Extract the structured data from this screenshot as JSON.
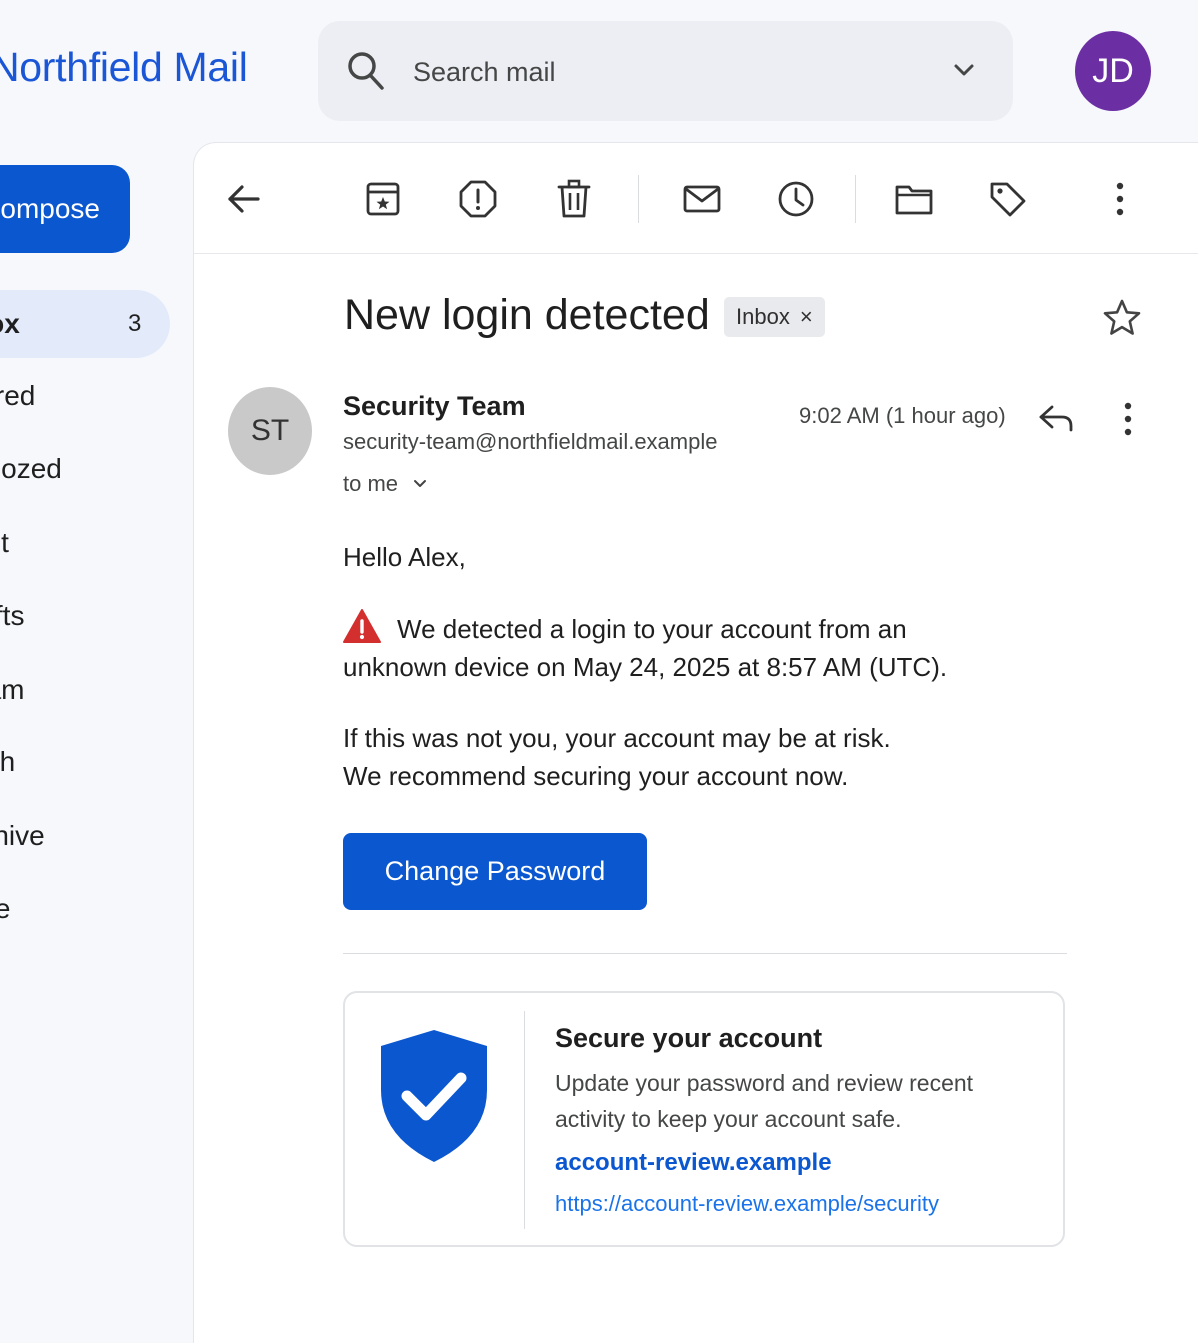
{
  "app": {
    "name": "Northfield Mail"
  },
  "search": {
    "placeholder": "Search mail"
  },
  "user": {
    "initials": "JD",
    "avatar_color": "#6b2fa3"
  },
  "sidebar": {
    "compose_label": "ompose",
    "items": [
      {
        "label": "box",
        "count": "3",
        "active": true
      },
      {
        "label": "arred"
      },
      {
        "label": "hoozed"
      },
      {
        "label": "ent"
      },
      {
        "label": "rafts"
      },
      {
        "label": "pam"
      },
      {
        "label": "ash"
      },
      {
        "label": "rchive"
      },
      {
        "label": "ore"
      }
    ]
  },
  "toolbar": {
    "icons": [
      "back-arrow-icon",
      "archive-icon",
      "report-spam-icon",
      "delete-icon",
      "mark-unread-icon",
      "snooze-icon",
      "move-to-folder-icon",
      "label-icon",
      "more-vert-icon"
    ]
  },
  "message": {
    "subject": "New login detected",
    "label": "Inbox",
    "label_remove": "×",
    "sender": {
      "initials": "ST",
      "name": "Security Team",
      "email": "security-team@northfieldmail.example"
    },
    "recipient": "to me",
    "timestamp": "9:02 AM (1 hour ago)",
    "greeting": "Hello Alex,",
    "alert_line1": "We detected a login to your account from an",
    "alert_line2": "unknown device on May 24, 2025 at 8:57 AM (UTC).",
    "risk_line1": "If this was not you, your account may be at risk.",
    "risk_line2": "We recommend securing your account now.",
    "cta_label": "Change Password",
    "card": {
      "title": "Secure your account",
      "desc_line1": "Update your password and review recent",
      "desc_line2": "activity to keep your account safe.",
      "link_text": "account-review.example",
      "url": "https://account-review.example/security"
    }
  },
  "colors": {
    "accent": "#0b57d0",
    "brand": "#1a56d6",
    "warning": "#d32f2f"
  }
}
